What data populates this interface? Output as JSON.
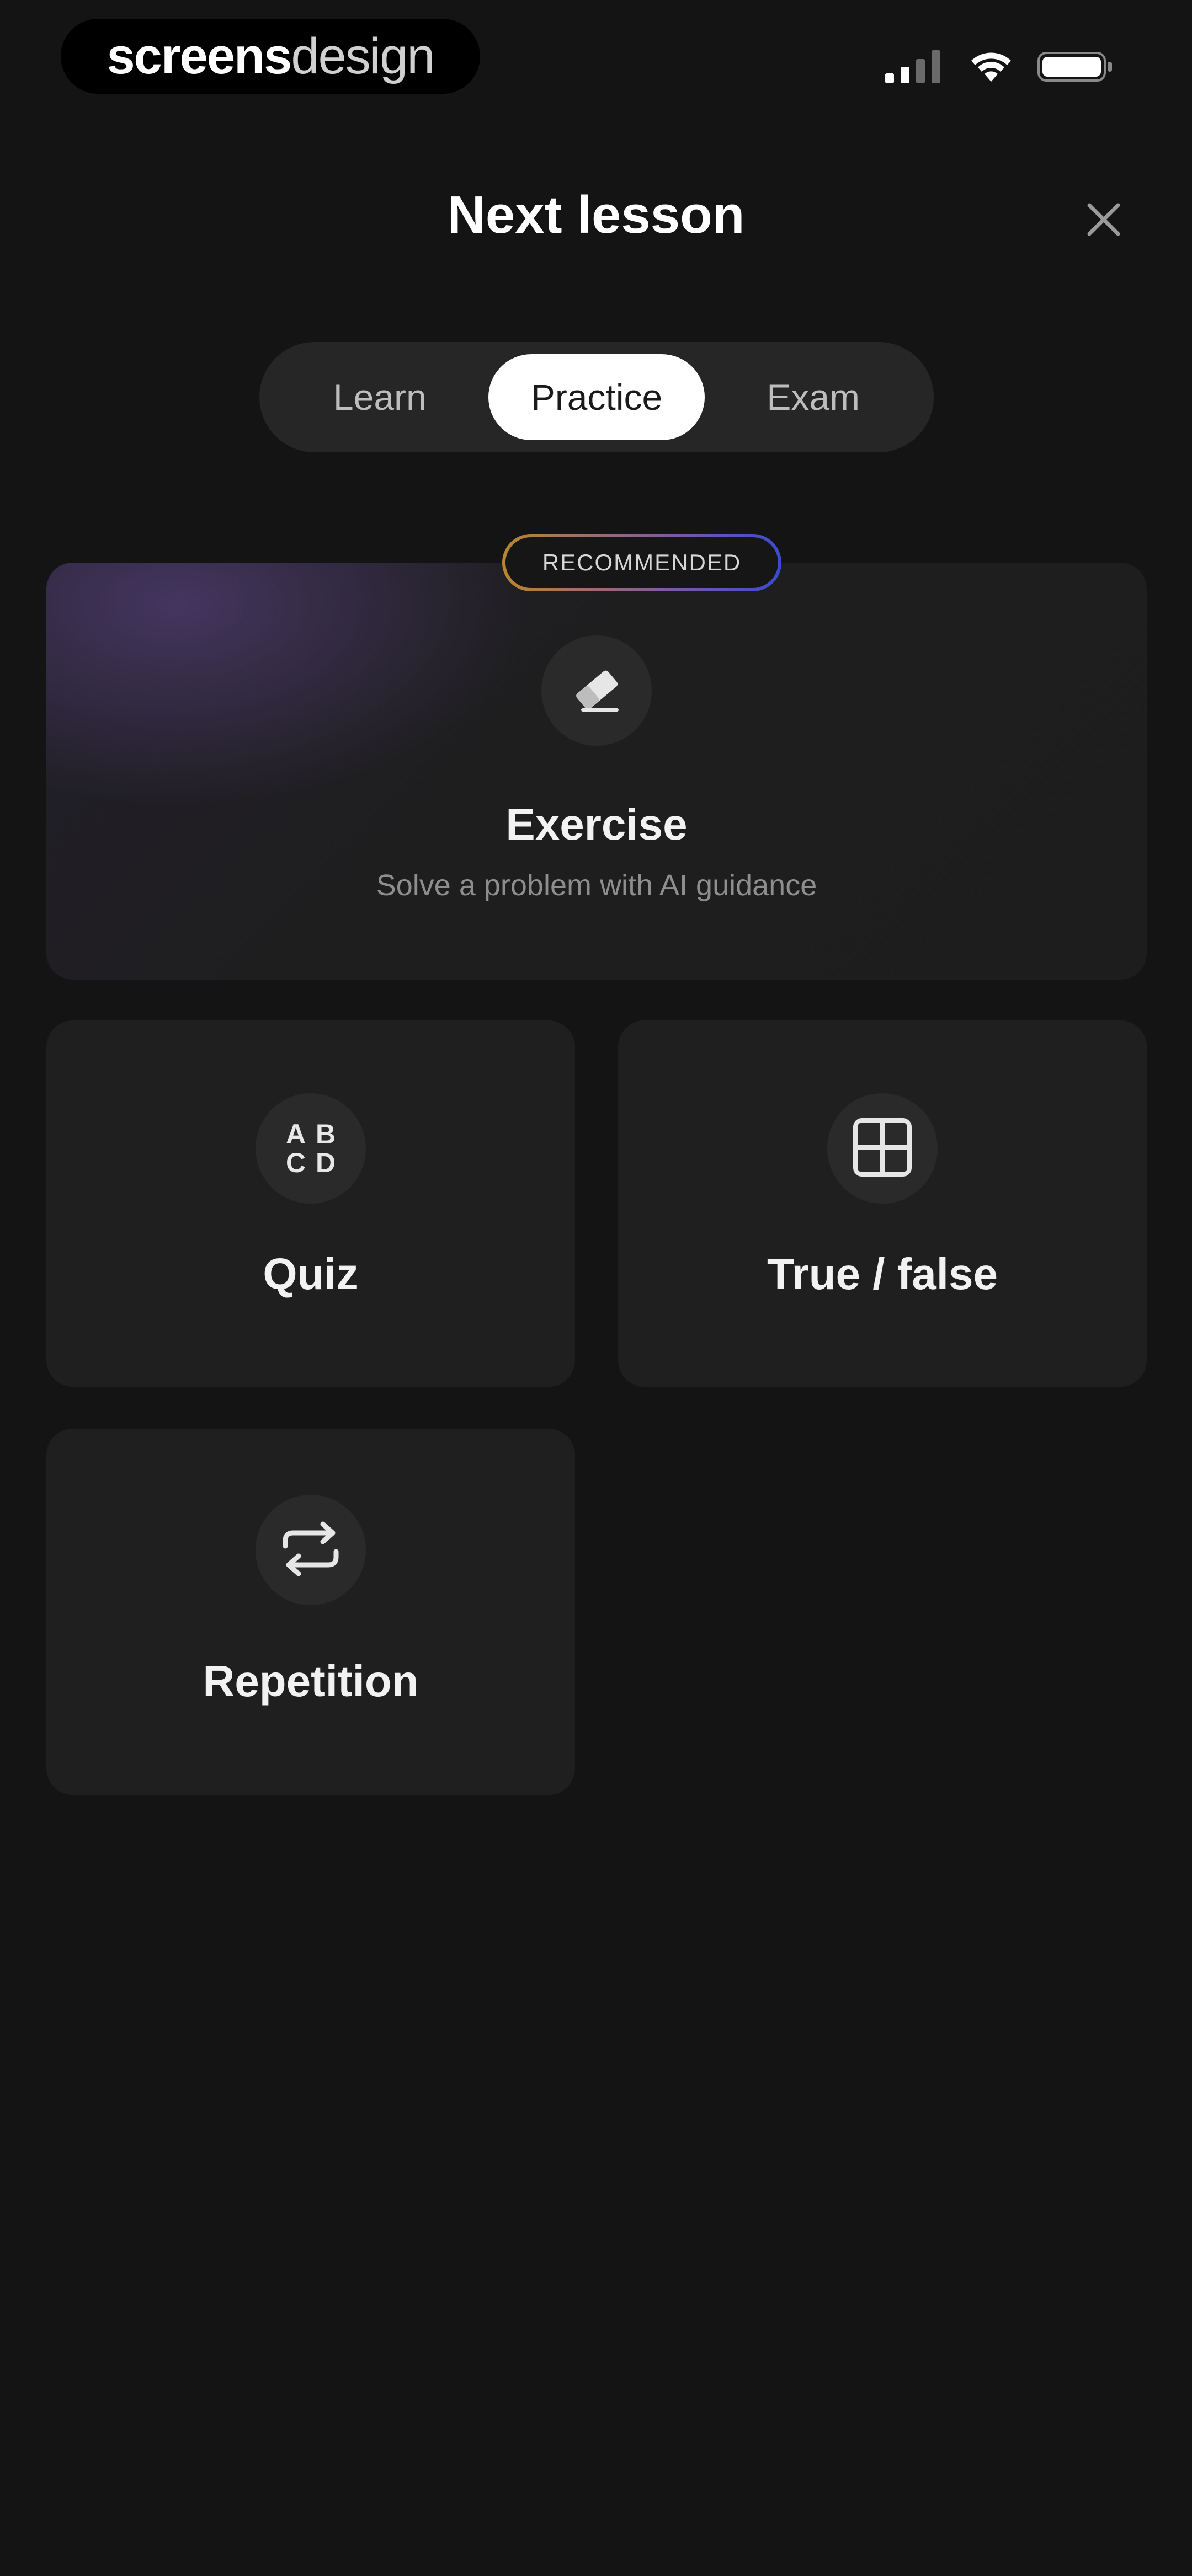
{
  "status_bar": {
    "brand_bold": "screens",
    "brand_light": "design",
    "icons": [
      "cellular-signal-icon",
      "wifi-icon",
      "battery-icon"
    ]
  },
  "header": {
    "title": "Next lesson",
    "close_icon": "close-icon"
  },
  "segmented_control": {
    "tabs": [
      {
        "label": "Learn",
        "active": false
      },
      {
        "label": "Practice",
        "active": true
      },
      {
        "label": "Exam",
        "active": false
      }
    ]
  },
  "featured_card": {
    "badge": "RECOMMENDED",
    "icon": "eraser-icon",
    "title": "Exercise",
    "subtitle": "Solve a problem with AI guidance"
  },
  "cards": [
    {
      "title": "Quiz",
      "icon": "abcd-icon",
      "icon_letters": [
        "A",
        "B",
        "C",
        "D"
      ]
    },
    {
      "title": "True / false",
      "icon": "grid-icon"
    },
    {
      "title": "Repetition",
      "icon": "repeat-icon"
    }
  ],
  "colors": {
    "background": "#141414",
    "card": "#1f1f1f",
    "active_tab": "#ffffff",
    "badge_gradient_start": "#b8862e",
    "badge_gradient_end": "#3a4bd0"
  }
}
